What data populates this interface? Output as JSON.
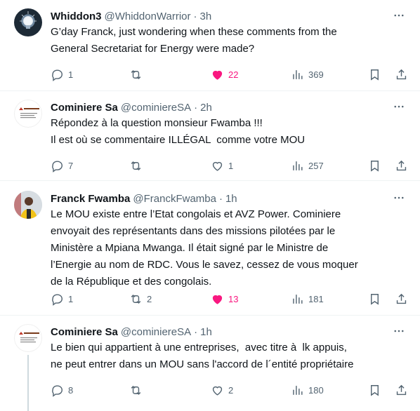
{
  "tweets": [
    {
      "name": "Whiddon3",
      "handle": "@WhiddonWarrior",
      "dot": "·",
      "time": "3h",
      "text": "G’day Franck, just wondering when these comments from the\nGeneral Secretariat for Energy were made?",
      "replies": "1",
      "retweets": "",
      "likes": "22",
      "views": "369",
      "liked": true
    },
    {
      "name": "Cominiere Sa",
      "handle": "@cominiereSA",
      "dot": "·",
      "time": "2h",
      "text": "Répondez à la question monsieur Fwamba !!!\nIl est où se commentaire ILLÉGAL  comme votre MOU",
      "replies": "7",
      "retweets": "",
      "likes": "1",
      "views": "257",
      "liked": false
    },
    {
      "name": "Franck Fwamba",
      "handle": "@FranckFwamba",
      "dot": "·",
      "time": "1h",
      "text": "Le MOU existe entre l’Etat congolais et AVZ Power. Cominiere\nenvoyait des représentants dans des missions pilotées par le\nMinistère a Mpiana Mwanga. Il était signé par le Ministre de\nl’Energie au nom de RDC. Vous le savez, cessez de vous moquer\nde la République et des congolais.",
      "replies": "1",
      "retweets": "2",
      "likes": "13",
      "views": "181",
      "liked": true
    },
    {
      "name": "Cominiere Sa",
      "handle": "@cominiereSA",
      "dot": "·",
      "time": "1h",
      "text": "Le bien qui appartient à une entreprises,  avec titre à  lk appuis,\nne peut entrer dans un MOU sans l'accord de l´entité propriétaire",
      "replies": "8",
      "retweets": "",
      "likes": "2",
      "views": "180",
      "liked": false
    }
  ],
  "colors": {
    "text": "#0f1419",
    "secondary": "#536471",
    "like": "#f91880",
    "thread_line": "#cfd9de"
  }
}
